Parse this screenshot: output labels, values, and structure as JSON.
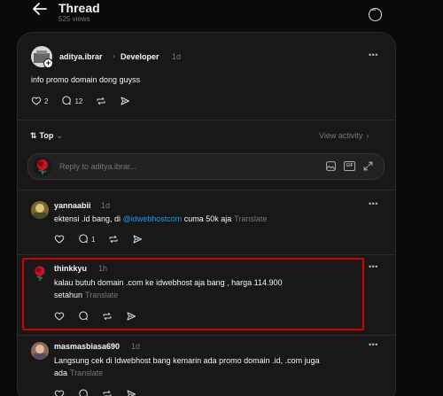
{
  "header": {
    "title": "Thread",
    "views": "525 views"
  },
  "post": {
    "username": "aditya.ibrar",
    "breadcrumb": "Developer",
    "time": "1d",
    "text": "info promo domain dong guyss",
    "likes": "2",
    "comments": "12"
  },
  "sort": {
    "label": "Top",
    "view_activity": "View activity"
  },
  "reply": {
    "placeholder": "Reply to aditya.ibrar..."
  },
  "comments": [
    {
      "username": "yannaabii",
      "time": "1d",
      "text_prefix": "ektensi .id bang, di ",
      "mention": "@idwebhostcom",
      "text_suffix": " cuma 50k aja",
      "translate": "Translate",
      "comments": "1"
    },
    {
      "username": "thinkkyu",
      "time": "1h",
      "text_line1": "kalau butuh domain .com ke idwebhost aja bang , harga 114.900",
      "text_line2": "setahun",
      "translate": "Translate"
    },
    {
      "username": "masmasbiasa690",
      "time": "1d",
      "text_line1": "Langsung cek di Idwebhost bang kemarin ada promo domain .id, .com juga",
      "text_line2": "ada",
      "translate": "Translate"
    }
  ],
  "colors": {
    "background": "#0a0a0a",
    "card": "#181818",
    "mention": "#1d9bf0",
    "highlight": "#d40000"
  }
}
